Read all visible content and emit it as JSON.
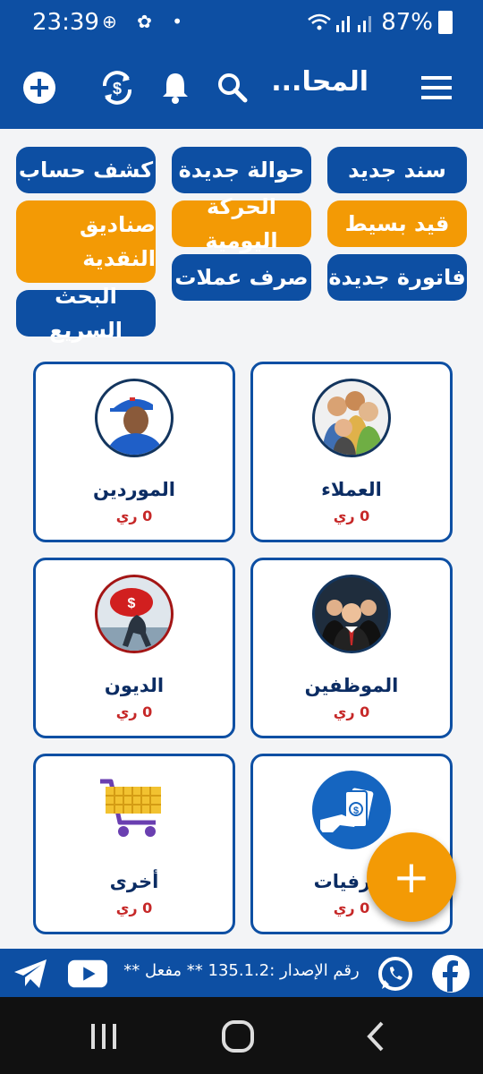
{
  "status": {
    "time": "23:39",
    "battery": "87%"
  },
  "appbar": {
    "title": "المحا...",
    "icons": [
      "menu-icon",
      "search-icon",
      "bell-icon",
      "sync-currency-icon",
      "add-icon"
    ]
  },
  "quick_actions": [
    {
      "label": "سند جديد",
      "color": "#0d4fa3"
    },
    {
      "label": "حوالة جديدة",
      "color": "#0d4fa3"
    },
    {
      "label": "كشف حساب",
      "color": "#0d4fa3"
    },
    {
      "label": "قيد بسيط",
      "color": "#f39a05"
    },
    {
      "label": "الحركة اليومية",
      "color": "#f39a05"
    },
    {
      "label": "صناديق النقدية",
      "color": "#f39a05"
    },
    {
      "label": "فاتورة جديدة",
      "color": "#0d4fa3"
    },
    {
      "label": "صرف عملات",
      "color": "#0d4fa3"
    },
    {
      "label": "البحث السريع",
      "color": "#0d4fa3"
    }
  ],
  "cards": [
    {
      "label": "العملاء",
      "balance": "0 ري",
      "icon": "customers-group-icon"
    },
    {
      "label": "الموردين",
      "balance": "0 ري",
      "icon": "supplier-delivery-man-icon"
    },
    {
      "label": "الموظفين",
      "balance": "0 ري",
      "icon": "employees-group-icon"
    },
    {
      "label": "الديون",
      "balance": "0 ري",
      "icon": "debt-burden-icon"
    },
    {
      "label": "صرفيات",
      "balance": "0 ري",
      "icon": "expenses-cash-hand-icon"
    },
    {
      "label": "أخرى",
      "balance": "0 ري",
      "icon": "shopping-cart-icon"
    }
  ],
  "footer": {
    "text": "رقم الإصدار :135.1.2   **  مفعل  **"
  },
  "colors": {
    "primary": "#0d4fa3",
    "accent": "#f39a05",
    "balance": "#c62828"
  }
}
